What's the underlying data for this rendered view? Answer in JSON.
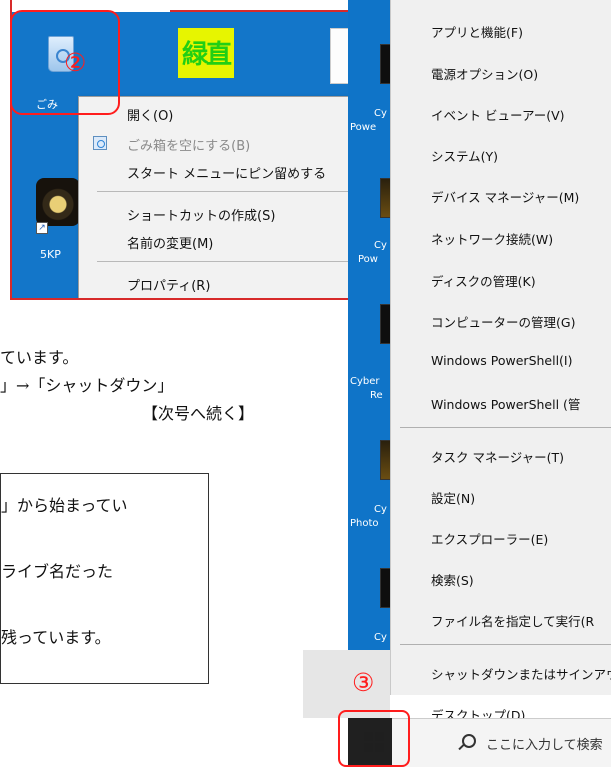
{
  "desktop_left": {
    "recycle_label": "ごみ",
    "fivekp_label": "5KP",
    "yellow_tile_text": "緑直",
    "callout_number": "②",
    "context_menu": {
      "items": [
        {
          "label": "開く(O)",
          "disabled": false
        },
        {
          "label": "ごみ箱を空にする(B)",
          "disabled": true
        },
        {
          "label": "スタート メニューにピン留めする",
          "disabled": false
        },
        {
          "label": "ショートカットの作成(S)",
          "disabled": false
        },
        {
          "label": "名前の変更(M)",
          "disabled": false
        },
        {
          "label": "プロパティ(R)",
          "disabled": false
        }
      ]
    }
  },
  "winx_menu": {
    "items": [
      "アプリと機能(F)",
      "電源オプション(O)",
      "イベント ビューアー(V)",
      "システム(Y)",
      "デバイス マネージャー(M)",
      "ネットワーク接続(W)",
      "ディスクの管理(K)",
      "コンピューターの管理(G)",
      "Windows PowerShell(I)",
      "Windows PowerShell (管",
      "タスク マネージャー(T)",
      "設定(N)",
      "エクスプローラー(E)",
      "検索(S)",
      "ファイル名を指定して実行(R",
      "シャットダウンまたはサインアウ",
      "デスクトップ(D)"
    ],
    "desktop_labels": [
      "Cy",
      "Powe",
      "Cy",
      "Pow",
      "Cyber",
      "Re",
      "Cy",
      "Photo",
      "Cy"
    ],
    "search_placeholder": "ここに入力して検索",
    "callout_number": "③"
  },
  "body_text": {
    "line1": "ています。",
    "line2": "」→「シャットダウン」",
    "line3": "【次号へ続く】"
  },
  "note": {
    "line1": "」から始まってい",
    "line2": "ライブ名だった",
    "line3": "残っています。"
  }
}
